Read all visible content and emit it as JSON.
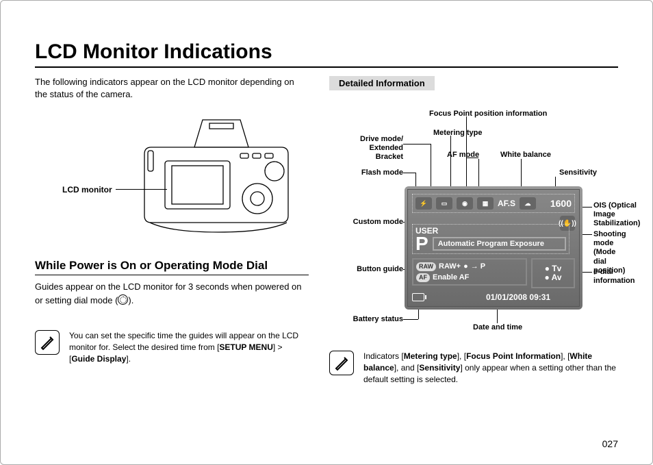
{
  "title": "LCD Monitor Indications",
  "intro": "The following indicators appear on the LCD monitor depending on the status of the camera.",
  "lcd_monitor_label": "LCD monitor",
  "section2_title": "While Power is On or Operating Mode Dial",
  "guide_text_a": "Guides appear on the LCD monitor for 3 seconds when powered on or setting dial mode (",
  "guide_text_b": ").",
  "note1_a": "You can set the specific time the guides will appear on the LCD monitor for. Select the desired time from [",
  "note1_b": "SETUP MENU",
  "note1_c": "] > [",
  "note1_d": "Guide Display",
  "note1_e": "].",
  "det_tab": "Detailed Information",
  "labels": {
    "drive": "Drive mode/\nExtended Bracket",
    "flash": "Flash mode",
    "custom": "Custom mode",
    "button_guide": "Button guide",
    "battery": "Battery status",
    "focus_point": "Focus Point position information",
    "metering": "Metering type",
    "af_mode": "AF mode",
    "white_balance": "White balance",
    "sensitivity": "Sensitivity",
    "ois": "OIS (Optical Image\nStabilization)",
    "shoot_mode": "Shooting mode\n(Mode dial position)",
    "edial": "e-dial information",
    "datetime": "Date and time"
  },
  "lcd": {
    "afs": "AF.S",
    "sens": "1600",
    "user": "USER",
    "mode_letter": "P",
    "mode_desc": "Automatic Program Exposure",
    "raw": "RAW",
    "rawplus": "RAW+",
    "arrow_p": "→ P",
    "af": "AF",
    "enableaf": "Enable AF",
    "tv": "Tv",
    "av": "Av",
    "circ": "●",
    "datetime": "01/01/2008  09:31"
  },
  "note2_a": "Indicators [",
  "note2_b": "Metering type",
  "note2_c": "], [",
  "note2_d": "Focus Point Information",
  "note2_e": "], [",
  "note2_f": "White balance",
  "note2_g": "], and [",
  "note2_h": "Sensitivity",
  "note2_i": "] only appear when a setting other than the default setting is selected.",
  "page_number": "027"
}
